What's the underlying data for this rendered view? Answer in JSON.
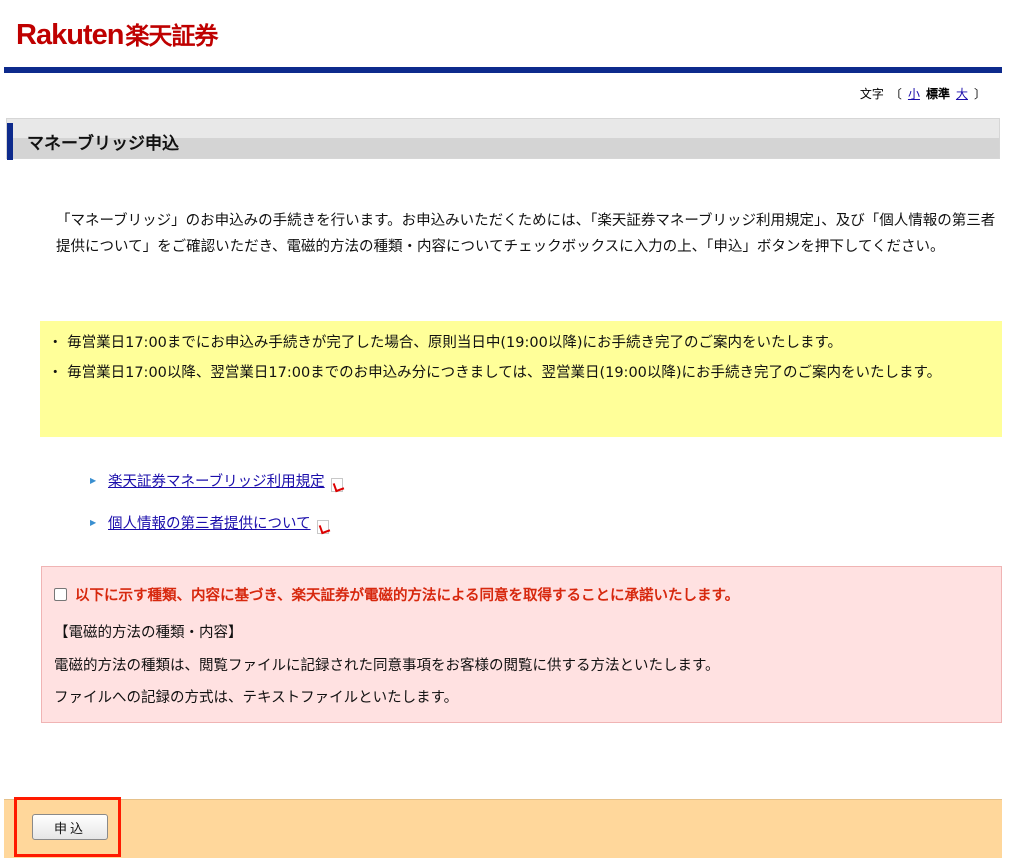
{
  "brand": {
    "en": "Rakuten",
    "ja": "楽天証券",
    "color": "#bf0000"
  },
  "font_size_control": {
    "label": "文字",
    "open_bracket": "〔",
    "small": "小",
    "standard": "標準",
    "large": "大",
    "close_bracket": "〕"
  },
  "page_title": "マネーブリッジ申込",
  "intro": "「マネーブリッジ」のお申込みの手続きを行います。お申込みいただくためには、「楽天証券マネーブリッジ利用規定」、及び「個人情報の第三者提供について」をご確認いただき、電磁的方法の種類・内容についてチェックボックスに入力の上、「申込」ボタンを押下してください。",
  "notice": [
    "・ 毎営業日17:00までにお申込み手続きが完了した場合、原則当日中(19:00以降)にお手続き完了のご案内をいたします。",
    "・ 毎営業日17:00以降、翌営業日17:00までのお申込み分につきましては、翌営業日(19:00以降)にお手続き完了のご案内をいたします。"
  ],
  "links": [
    "楽天証券マネーブリッジ利用規定",
    "個人情報の第三者提供について"
  ],
  "consent": {
    "checked": false,
    "checkbox_label": "以下に示す種類、内容に基づき、楽天証券が電磁的方法による同意を取得することに承諾いたします。",
    "section_heading": "【電磁的方法の種類・内容】",
    "line1": "電磁的方法の種類は、閲覧ファイルに記録された同意事項をお客様の閲覧に供する方法といたします。",
    "line2": "ファイルへの記録の方式は、テキストファイルといたします。"
  },
  "submit_button": "申込",
  "colors": {
    "header_bar": "#0d2a8c",
    "notice_bg": "#ffff99",
    "consent_bg": "#ffe1e1",
    "consent_text": "#d7280e",
    "footer_bg": "#ffd79b",
    "highlight": "#ff1a00"
  }
}
